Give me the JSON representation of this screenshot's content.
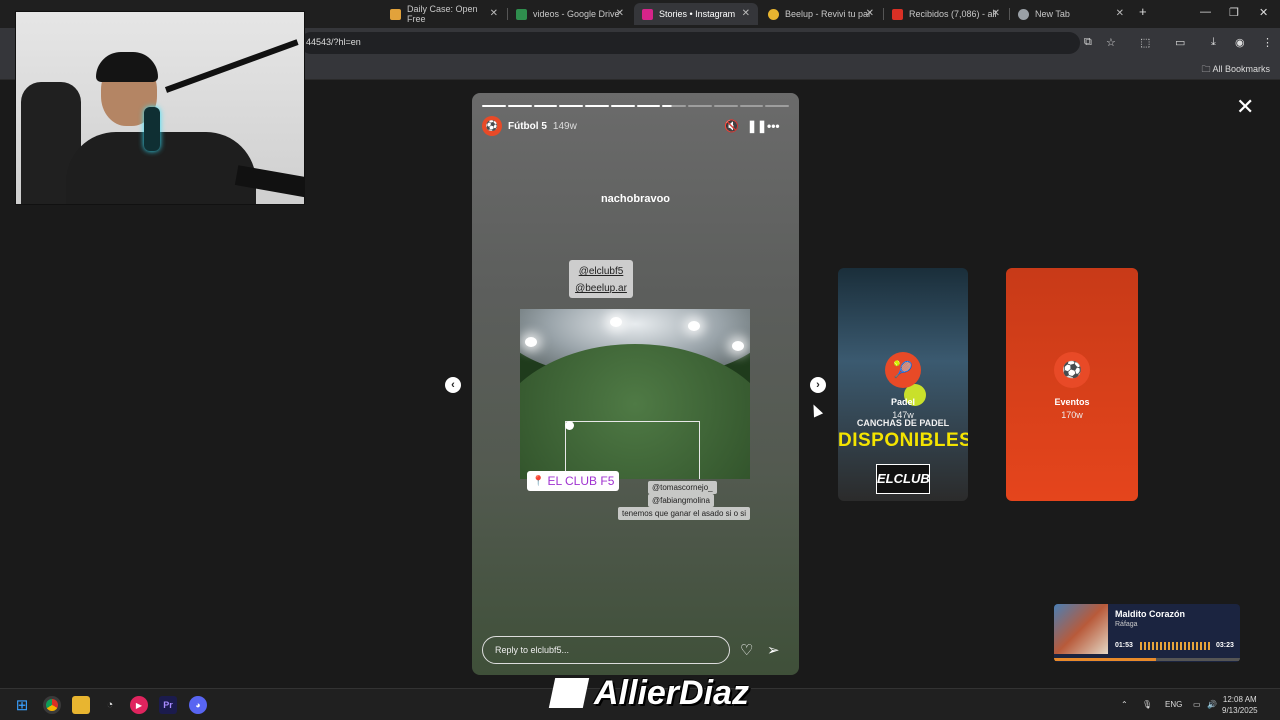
{
  "browser": {
    "tabs": [
      {
        "title": "Daily Case: Open Free",
        "color": "#e2a23b"
      },
      {
        "title": "videos - Google Drive",
        "color": "#2f8e4e"
      },
      {
        "title": "Stories • Instagram",
        "color": "#d6248a",
        "active": true
      },
      {
        "title": "Beelup - Revivi tu par",
        "color": "#e8b530"
      },
      {
        "title": "Recibidos (7,086) - all",
        "color": "#d93025"
      },
      {
        "title": "New Tab",
        "color": "#9aa0a6"
      }
    ],
    "new_tab": "+",
    "url_fragment": "44543/?hl=en",
    "bookmarks_label": "All Bookmarks"
  },
  "story": {
    "username": "Fútbol 5",
    "time": "149w",
    "progress": {
      "total": 12,
      "completed": 7
    },
    "overlay_username": "nachobravoo",
    "mentions": [
      "@elclubf5",
      "@beelup.ar"
    ],
    "location": "EL CLUB F5",
    "tags": [
      "@tomascornejo_",
      "@fabiangmolina",
      "tenemos que ganar el asado si o si"
    ],
    "reply_placeholder": "Reply to elclubf5..."
  },
  "previews": [
    {
      "name": "Padel",
      "time": "147w",
      "headline": "CANCHAS DE PADEL",
      "big": "DISPONIBLES",
      "logo": "ELCLUB"
    },
    {
      "name": "Eventos",
      "time": "170w"
    }
  ],
  "music": {
    "song": "Maldito Corazón",
    "artist": "Ráfaga",
    "elapsed": "01:53",
    "duration": "03:23",
    "progress": 0.55
  },
  "watermark": "AllierDiaz",
  "taskbar": {
    "lang": "ENG",
    "time": "12:08 AM",
    "date": "9/13/2025"
  }
}
